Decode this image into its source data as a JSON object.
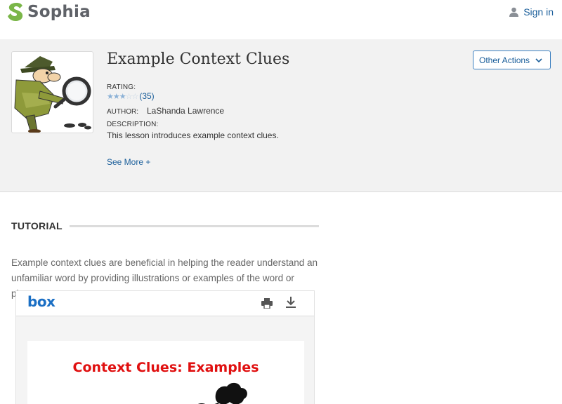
{
  "brand": {
    "name": "Sophia",
    "logo_color": "#7ab648"
  },
  "nav": {
    "signin_label": "Sign in",
    "signin_icon": "person-icon"
  },
  "lesson": {
    "title": "Example Context Clues",
    "rating_label": "RATING:",
    "rating_value": 3,
    "rating_max": 5,
    "rating_count": "(35)",
    "author_label": "AUTHOR:",
    "author_name": "LaShanda Lawrence",
    "description_label": "DESCRIPTION:",
    "description": "This lesson introduces example context clues.",
    "see_more_label": "See More +",
    "actions_label": "Other Actions"
  },
  "tutorial": {
    "section_title": "TUTORIAL",
    "intro_text": "Example context clues are beneficial in helping the reader understand an unfamiliar word by providing illustrations or examples of the word or phrase."
  },
  "viewer": {
    "logo_text": "box",
    "print_icon": "print-icon",
    "download_icon": "download-icon",
    "slide_title": "Context Clues: Examples"
  },
  "colors": {
    "link": "#1a5e9a",
    "accent_border": "#3b7fc0",
    "slide_title": "#e01010"
  }
}
